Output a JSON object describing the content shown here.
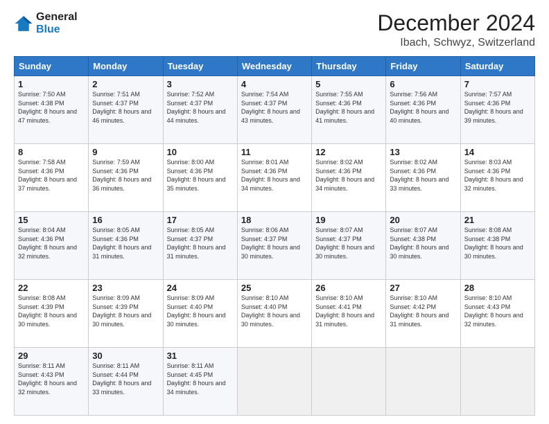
{
  "header": {
    "logo_line1": "General",
    "logo_line2": "Blue",
    "month": "December 2024",
    "location": "Ibach, Schwyz, Switzerland"
  },
  "weekdays": [
    "Sunday",
    "Monday",
    "Tuesday",
    "Wednesday",
    "Thursday",
    "Friday",
    "Saturday"
  ],
  "weeks": [
    [
      {
        "day": "1",
        "sunrise": "Sunrise: 7:50 AM",
        "sunset": "Sunset: 4:38 PM",
        "daylight": "Daylight: 8 hours and 47 minutes."
      },
      {
        "day": "2",
        "sunrise": "Sunrise: 7:51 AM",
        "sunset": "Sunset: 4:37 PM",
        "daylight": "Daylight: 8 hours and 46 minutes."
      },
      {
        "day": "3",
        "sunrise": "Sunrise: 7:52 AM",
        "sunset": "Sunset: 4:37 PM",
        "daylight": "Daylight: 8 hours and 44 minutes."
      },
      {
        "day": "4",
        "sunrise": "Sunrise: 7:54 AM",
        "sunset": "Sunset: 4:37 PM",
        "daylight": "Daylight: 8 hours and 43 minutes."
      },
      {
        "day": "5",
        "sunrise": "Sunrise: 7:55 AM",
        "sunset": "Sunset: 4:36 PM",
        "daylight": "Daylight: 8 hours and 41 minutes."
      },
      {
        "day": "6",
        "sunrise": "Sunrise: 7:56 AM",
        "sunset": "Sunset: 4:36 PM",
        "daylight": "Daylight: 8 hours and 40 minutes."
      },
      {
        "day": "7",
        "sunrise": "Sunrise: 7:57 AM",
        "sunset": "Sunset: 4:36 PM",
        "daylight": "Daylight: 8 hours and 39 minutes."
      }
    ],
    [
      {
        "day": "8",
        "sunrise": "Sunrise: 7:58 AM",
        "sunset": "Sunset: 4:36 PM",
        "daylight": "Daylight: 8 hours and 37 minutes."
      },
      {
        "day": "9",
        "sunrise": "Sunrise: 7:59 AM",
        "sunset": "Sunset: 4:36 PM",
        "daylight": "Daylight: 8 hours and 36 minutes."
      },
      {
        "day": "10",
        "sunrise": "Sunrise: 8:00 AM",
        "sunset": "Sunset: 4:36 PM",
        "daylight": "Daylight: 8 hours and 35 minutes."
      },
      {
        "day": "11",
        "sunrise": "Sunrise: 8:01 AM",
        "sunset": "Sunset: 4:36 PM",
        "daylight": "Daylight: 8 hours and 34 minutes."
      },
      {
        "day": "12",
        "sunrise": "Sunrise: 8:02 AM",
        "sunset": "Sunset: 4:36 PM",
        "daylight": "Daylight: 8 hours and 34 minutes."
      },
      {
        "day": "13",
        "sunrise": "Sunrise: 8:02 AM",
        "sunset": "Sunset: 4:36 PM",
        "daylight": "Daylight: 8 hours and 33 minutes."
      },
      {
        "day": "14",
        "sunrise": "Sunrise: 8:03 AM",
        "sunset": "Sunset: 4:36 PM",
        "daylight": "Daylight: 8 hours and 32 minutes."
      }
    ],
    [
      {
        "day": "15",
        "sunrise": "Sunrise: 8:04 AM",
        "sunset": "Sunset: 4:36 PM",
        "daylight": "Daylight: 8 hours and 32 minutes."
      },
      {
        "day": "16",
        "sunrise": "Sunrise: 8:05 AM",
        "sunset": "Sunset: 4:36 PM",
        "daylight": "Daylight: 8 hours and 31 minutes."
      },
      {
        "day": "17",
        "sunrise": "Sunrise: 8:05 AM",
        "sunset": "Sunset: 4:37 PM",
        "daylight": "Daylight: 8 hours and 31 minutes."
      },
      {
        "day": "18",
        "sunrise": "Sunrise: 8:06 AM",
        "sunset": "Sunset: 4:37 PM",
        "daylight": "Daylight: 8 hours and 30 minutes."
      },
      {
        "day": "19",
        "sunrise": "Sunrise: 8:07 AM",
        "sunset": "Sunset: 4:37 PM",
        "daylight": "Daylight: 8 hours and 30 minutes."
      },
      {
        "day": "20",
        "sunrise": "Sunrise: 8:07 AM",
        "sunset": "Sunset: 4:38 PM",
        "daylight": "Daylight: 8 hours and 30 minutes."
      },
      {
        "day": "21",
        "sunrise": "Sunrise: 8:08 AM",
        "sunset": "Sunset: 4:38 PM",
        "daylight": "Daylight: 8 hours and 30 minutes."
      }
    ],
    [
      {
        "day": "22",
        "sunrise": "Sunrise: 8:08 AM",
        "sunset": "Sunset: 4:39 PM",
        "daylight": "Daylight: 8 hours and 30 minutes."
      },
      {
        "day": "23",
        "sunrise": "Sunrise: 8:09 AM",
        "sunset": "Sunset: 4:39 PM",
        "daylight": "Daylight: 8 hours and 30 minutes."
      },
      {
        "day": "24",
        "sunrise": "Sunrise: 8:09 AM",
        "sunset": "Sunset: 4:40 PM",
        "daylight": "Daylight: 8 hours and 30 minutes."
      },
      {
        "day": "25",
        "sunrise": "Sunrise: 8:10 AM",
        "sunset": "Sunset: 4:40 PM",
        "daylight": "Daylight: 8 hours and 30 minutes."
      },
      {
        "day": "26",
        "sunrise": "Sunrise: 8:10 AM",
        "sunset": "Sunset: 4:41 PM",
        "daylight": "Daylight: 8 hours and 31 minutes."
      },
      {
        "day": "27",
        "sunrise": "Sunrise: 8:10 AM",
        "sunset": "Sunset: 4:42 PM",
        "daylight": "Daylight: 8 hours and 31 minutes."
      },
      {
        "day": "28",
        "sunrise": "Sunrise: 8:10 AM",
        "sunset": "Sunset: 4:43 PM",
        "daylight": "Daylight: 8 hours and 32 minutes."
      }
    ],
    [
      {
        "day": "29",
        "sunrise": "Sunrise: 8:11 AM",
        "sunset": "Sunset: 4:43 PM",
        "daylight": "Daylight: 8 hours and 32 minutes."
      },
      {
        "day": "30",
        "sunrise": "Sunrise: 8:11 AM",
        "sunset": "Sunset: 4:44 PM",
        "daylight": "Daylight: 8 hours and 33 minutes."
      },
      {
        "day": "31",
        "sunrise": "Sunrise: 8:11 AM",
        "sunset": "Sunset: 4:45 PM",
        "daylight": "Daylight: 8 hours and 34 minutes."
      },
      null,
      null,
      null,
      null
    ]
  ]
}
